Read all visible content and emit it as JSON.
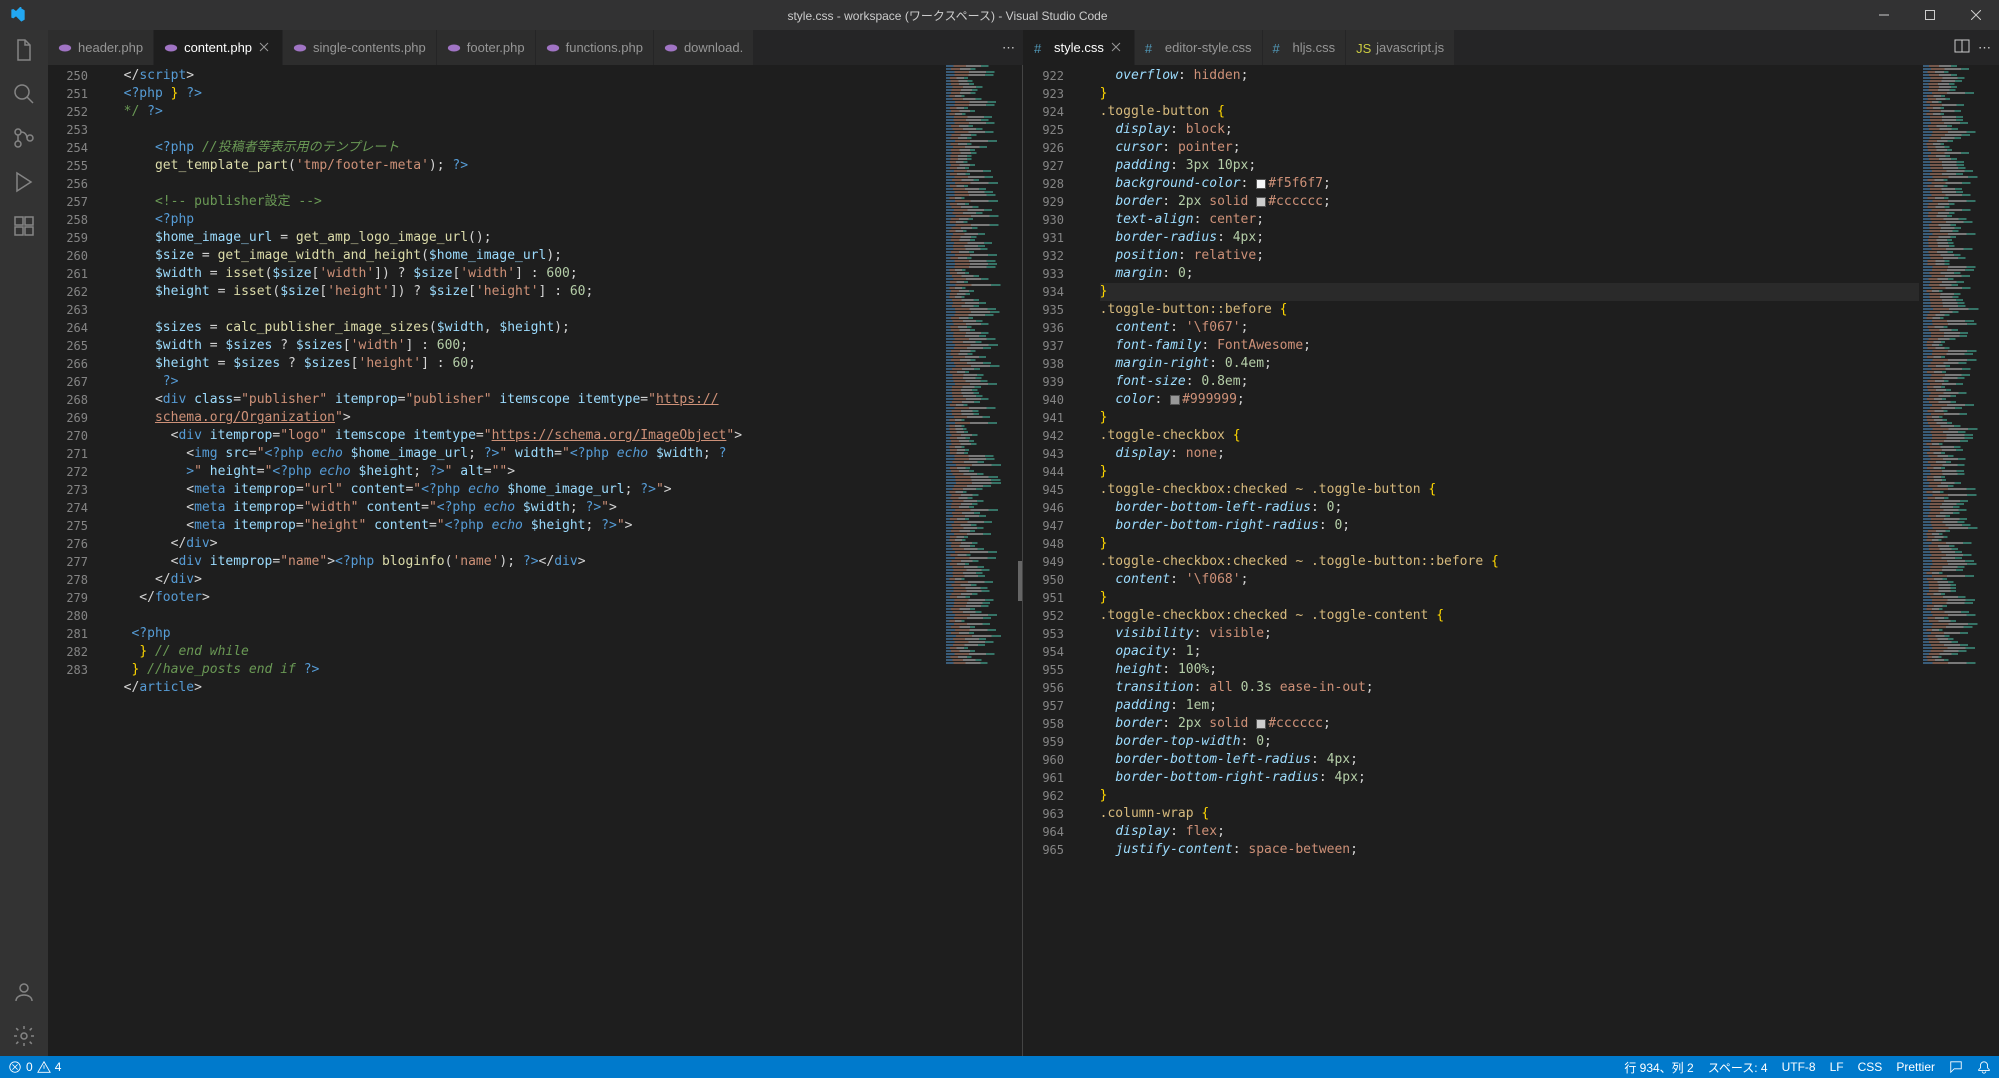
{
  "title": "style.css - workspace (ワークスペース) - Visual Studio Code",
  "activity": [
    "files",
    "search",
    "source-control",
    "run",
    "extensions"
  ],
  "activity_bottom": [
    "account",
    "gear"
  ],
  "left_tabs": [
    {
      "icon": "php",
      "label": "header.php",
      "close": false
    },
    {
      "icon": "php",
      "label": "content.php",
      "close": true,
      "active": true
    },
    {
      "icon": "php",
      "label": "single-contents.php",
      "close": false
    },
    {
      "icon": "php",
      "label": "footer.php",
      "close": false
    },
    {
      "icon": "php",
      "label": "functions.php",
      "close": false
    },
    {
      "icon": "php",
      "label": "download.",
      "close": false
    }
  ],
  "right_tabs": [
    {
      "icon": "css",
      "label": "style.css",
      "close": true,
      "active": true
    },
    {
      "icon": "css",
      "label": "editor-style.css",
      "close": false
    },
    {
      "icon": "css",
      "label": "hljs.css",
      "close": false
    },
    {
      "icon": "js",
      "label": "javascript.js",
      "close": false
    }
  ],
  "left_start_line": 250,
  "left_lines": [
    {
      "n": 250,
      "html": "  &lt;/<span class='tag'>script</span>&gt;"
    },
    {
      "n": 251,
      "html": "  <span class='phpdelim'>&lt;?php</span> <span class='brace'>}</span> <span class='phpdelim'>?&gt;</span>"
    },
    {
      "n": 252,
      "html": "  <span class='comment'>*/</span> <span class='phpdelim'>?&gt;</span>"
    },
    {
      "n": 253,
      "html": ""
    },
    {
      "n": 254,
      "html": "      <span class='phpdelim'>&lt;?php </span><span class='comment-i'>//投稿者等表示用のテンプレート</span>"
    },
    {
      "n": 255,
      "html": "      <span class='func'>get_template_part</span>(<span class='string'>'tmp/footer-meta'</span>); <span class='phpdelim'>?&gt;</span>"
    },
    {
      "n": 256,
      "html": ""
    },
    {
      "n": 257,
      "html": "      <span class='comment'>&lt;!-- publisher設定 --&gt;</span>"
    },
    {
      "n": 258,
      "html": "      <span class='phpdelim'>&lt;?php</span>"
    },
    {
      "n": 259,
      "html": "      <span class='var'>$home_image_url</span> = <span class='func'>get_amp_logo_image_url</span>();"
    },
    {
      "n": 260,
      "html": "      <span class='var'>$size</span> = <span class='func'>get_image_width_and_height</span>(<span class='var'>$home_image_url</span>);"
    },
    {
      "n": 261,
      "html": "      <span class='var'>$width</span> = <span class='func'>isset</span>(<span class='var'>$size</span>[<span class='string'>'width'</span>]) ? <span class='var'>$size</span>[<span class='string'>'width'</span>] : <span class='number'>600</span>;"
    },
    {
      "n": 262,
      "html": "      <span class='var'>$height</span> = <span class='func'>isset</span>(<span class='var'>$size</span>[<span class='string'>'height'</span>]) ? <span class='var'>$size</span>[<span class='string'>'height'</span>] : <span class='number'>60</span>;"
    },
    {
      "n": 263,
      "html": ""
    },
    {
      "n": 264,
      "html": "      <span class='var'>$sizes</span> = <span class='func'>calc_publisher_image_sizes</span>(<span class='var'>$width</span>, <span class='var'>$height</span>);"
    },
    {
      "n": 265,
      "html": "      <span class='var'>$width</span> = <span class='var'>$sizes</span> ? <span class='var'>$sizes</span>[<span class='string'>'width'</span>] : <span class='number'>600</span>;"
    },
    {
      "n": 266,
      "html": "      <span class='var'>$height</span> = <span class='var'>$sizes</span> ? <span class='var'>$sizes</span>[<span class='string'>'height'</span>] : <span class='number'>60</span>;"
    },
    {
      "n": 267,
      "html": "       <span class='phpdelim'>?&gt;</span>"
    },
    {
      "n": 268,
      "html": "      &lt;<span class='tag'>div</span> <span class='attr'>class</span>=<span class='string'>\"publisher\"</span> <span class='attr'>itemprop</span>=<span class='string'>\"publisher\"</span> <span class='attr'>itemscope</span> <span class='attr'>itemtype</span>=<span class='string'>\"<span class='url'>https://</span></span><br>      <span class='url'>schema.org/Organization</span><span class='string'>\"</span>&gt;"
    },
    {
      "n": 269,
      "html": "        &lt;<span class='tag'>div</span> <span class='attr'>itemprop</span>=<span class='string'>\"logo\"</span> <span class='attr'>itemscope</span> <span class='attr'>itemtype</span>=<span class='string'>\"<span class='url'>https://schema.org/ImageObject</span>\"</span>&gt;"
    },
    {
      "n": 270,
      "html": "          &lt;<span class='tag'>img</span> <span class='attr'>src</span>=<span class='string'>\"</span><span class='phpdelim'>&lt;?php</span> <span class='keyword'>echo</span> <span class='var'>$home_image_url</span>; <span class='phpdelim'>?&gt;</span><span class='string'>\"</span> <span class='attr'>width</span>=<span class='string'>\"</span><span class='phpdelim'>&lt;?php</span> <span class='keyword'>echo</span> <span class='var'>$width</span>; <span class='phpdelim'>?</span><br>          <span class='phpdelim'>&gt;</span><span class='string'>\"</span> <span class='attr'>height</span>=<span class='string'>\"</span><span class='phpdelim'>&lt;?php</span> <span class='keyword'>echo</span> <span class='var'>$height</span>; <span class='phpdelim'>?&gt;</span><span class='string'>\"</span> <span class='attr'>alt</span>=<span class='string'>\"\"</span>&gt;"
    },
    {
      "n": 271,
      "html": "          &lt;<span class='tag'>meta</span> <span class='attr'>itemprop</span>=<span class='string'>\"url\"</span> <span class='attr'>content</span>=<span class='string'>\"</span><span class='phpdelim'>&lt;?php</span> <span class='keyword'>echo</span> <span class='var'>$home_image_url</span>; <span class='phpdelim'>?&gt;</span><span class='string'>\"</span>&gt;"
    },
    {
      "n": 272,
      "html": "          &lt;<span class='tag'>meta</span> <span class='attr'>itemprop</span>=<span class='string'>\"width\"</span> <span class='attr'>content</span>=<span class='string'>\"</span><span class='phpdelim'>&lt;?php</span> <span class='keyword'>echo</span> <span class='var'>$width</span>; <span class='phpdelim'>?&gt;</span><span class='string'>\"</span>&gt;"
    },
    {
      "n": 273,
      "html": "          &lt;<span class='tag'>meta</span> <span class='attr'>itemprop</span>=<span class='string'>\"height\"</span> <span class='attr'>content</span>=<span class='string'>\"</span><span class='phpdelim'>&lt;?php</span> <span class='keyword'>echo</span> <span class='var'>$height</span>; <span class='phpdelim'>?&gt;</span><span class='string'>\"</span>&gt;"
    },
    {
      "n": 274,
      "html": "        &lt;/<span class='tag'>div</span>&gt;"
    },
    {
      "n": 275,
      "html": "        &lt;<span class='tag'>div</span> <span class='attr'>itemprop</span>=<span class='string'>\"name\"</span>&gt;<span class='phpdelim'>&lt;?php</span> <span class='func'>bloginfo</span>(<span class='string'>'name'</span>); <span class='phpdelim'>?&gt;</span>&lt;/<span class='tag'>div</span>&gt;"
    },
    {
      "n": 276,
      "html": "      &lt;/<span class='tag'>div</span>&gt;"
    },
    {
      "n": 277,
      "html": "    &lt;/<span class='tag'>footer</span>&gt;"
    },
    {
      "n": 278,
      "html": ""
    },
    {
      "n": 279,
      "html": "   <span class='phpdelim'>&lt;?php</span>"
    },
    {
      "n": 280,
      "html": "    <span class='brace'>}</span> <span class='comment-i'>// end while</span>"
    },
    {
      "n": 281,
      "html": "   <span class='brace'>}</span> <span class='comment-i'>//have_posts end if</span> <span class='phpdelim'>?&gt;</span>"
    },
    {
      "n": 282,
      "html": "  &lt;/<span class='tag'>article</span>&gt;"
    },
    {
      "n": 283,
      "html": ""
    }
  ],
  "right_start_line": 922,
  "right_lines": [
    {
      "n": 922,
      "html": "    <span class='prop'>overflow</span>: <span class='value'>hidden</span>;"
    },
    {
      "n": 923,
      "html": "  <span class='brace'>}</span>"
    },
    {
      "n": 924,
      "html": "  <span class='selector'>.toggle-button</span> <span class='brace'>{</span>"
    },
    {
      "n": 925,
      "html": "    <span class='prop'>display</span>: <span class='value'>block</span>;"
    },
    {
      "n": 926,
      "html": "    <span class='prop'>cursor</span>: <span class='value'>pointer</span>;"
    },
    {
      "n": 927,
      "html": "    <span class='prop'>padding</span>: <span class='num'>3</span><span class='unit'>px</span> <span class='num'>10</span><span class='unit'>px</span>;"
    },
    {
      "n": 928,
      "html": "    <span class='prop'>background-color</span>: <span class='color-swatch' style='background:#f5f6f7'></span><span class='value'>#f5f6f7</span>;"
    },
    {
      "n": 929,
      "html": "    <span class='prop'>border</span>: <span class='num'>2</span><span class='unit'>px</span> <span class='value'>solid</span> <span class='color-swatch' style='background:#cccccc'></span><span class='value'>#cccccc</span>;"
    },
    {
      "n": 930,
      "html": "    <span class='prop'>text-align</span>: <span class='value'>center</span>;"
    },
    {
      "n": 931,
      "html": "    <span class='prop'>border-radius</span>: <span class='num'>4</span><span class='unit'>px</span>;"
    },
    {
      "n": 932,
      "html": "    <span class='prop'>position</span>: <span class='value'>relative</span>;"
    },
    {
      "n": 933,
      "html": "    <span class='prop'>margin</span>: <span class='num'>0</span>;"
    },
    {
      "n": 934,
      "html": "  <span class='line-highlight'><span class='brace'>}</span></span>",
      "hl": true
    },
    {
      "n": 935,
      "html": "  <span class='selector'>.toggle-button::before</span> <span class='brace'>{</span>"
    },
    {
      "n": 936,
      "html": "    <span class='prop'>content</span>: <span class='string'>'\\f067'</span>;"
    },
    {
      "n": 937,
      "html": "    <span class='prop'>font-family</span>: <span class='value'>FontAwesome</span>;"
    },
    {
      "n": 938,
      "html": "    <span class='prop'>margin-right</span>: <span class='num'>0.4</span><span class='unit'>em</span>;"
    },
    {
      "n": 939,
      "html": "    <span class='prop'>font-size</span>: <span class='num'>0.8</span><span class='unit'>em</span>;"
    },
    {
      "n": 940,
      "html": "    <span class='prop'>color</span>: <span class='color-swatch' style='background:#999999'></span><span class='value'>#999999</span>;"
    },
    {
      "n": 941,
      "html": "  <span class='brace'>}</span>"
    },
    {
      "n": 942,
      "html": "  <span class='selector'>.toggle-checkbox</span> <span class='brace'>{</span>"
    },
    {
      "n": 943,
      "html": "    <span class='prop'>display</span>: <span class='value'>none</span>;"
    },
    {
      "n": 944,
      "html": "  <span class='brace'>}</span>"
    },
    {
      "n": 945,
      "html": "  <span class='selector'>.toggle-checkbox:checked ~ .toggle-button</span> <span class='brace'>{</span>"
    },
    {
      "n": 946,
      "html": "    <span class='prop'>border-bottom-left-radius</span>: <span class='num'>0</span>;"
    },
    {
      "n": 947,
      "html": "    <span class='prop'>border-bottom-right-radius</span>: <span class='num'>0</span>;"
    },
    {
      "n": 948,
      "html": "  <span class='brace'>}</span>"
    },
    {
      "n": 949,
      "html": "  <span class='selector'>.toggle-checkbox:checked ~ .toggle-button::before</span> <span class='brace'>{</span>"
    },
    {
      "n": 950,
      "html": "    <span class='prop'>content</span>: <span class='string'>'\\f068'</span>;"
    },
    {
      "n": 951,
      "html": "  <span class='brace'>}</span>"
    },
    {
      "n": 952,
      "html": "  <span class='selector'>.toggle-checkbox:checked ~ .toggle-content</span> <span class='brace'>{</span>"
    },
    {
      "n": 953,
      "html": "    <span class='prop'>visibility</span>: <span class='value'>visible</span>;"
    },
    {
      "n": 954,
      "html": "    <span class='prop'>opacity</span>: <span class='num'>1</span>;"
    },
    {
      "n": 955,
      "html": "    <span class='prop'>height</span>: <span class='num'>100</span><span class='unit'>%</span>;"
    },
    {
      "n": 956,
      "html": "    <span class='prop'>transition</span>: <span class='value'>all</span> <span class='num'>0.3</span><span class='unit'>s</span> <span class='value'>ease-in-out</span>;"
    },
    {
      "n": 957,
      "html": "    <span class='prop'>padding</span>: <span class='num'>1</span><span class='unit'>em</span>;"
    },
    {
      "n": 958,
      "html": "    <span class='prop'>border</span>: <span class='num'>2</span><span class='unit'>px</span> <span class='value'>solid</span> <span class='color-swatch' style='background:#cccccc'></span><span class='value'>#cccccc</span>;"
    },
    {
      "n": 959,
      "html": "    <span class='prop'>border-top-width</span>: <span class='num'>0</span>;"
    },
    {
      "n": 960,
      "html": "    <span class='prop'>border-bottom-left-radius</span>: <span class='num'>4</span><span class='unit'>px</span>;"
    },
    {
      "n": 961,
      "html": "    <span class='prop'>border-bottom-right-radius</span>: <span class='num'>4</span><span class='unit'>px</span>;"
    },
    {
      "n": 962,
      "html": "  <span class='brace'>}</span>"
    },
    {
      "n": 963,
      "html": "  <span class='selector'>.column-wrap</span> <span class='brace'>{</span>"
    },
    {
      "n": 964,
      "html": "    <span class='prop'>display</span>: <span class='value'>flex</span>;"
    },
    {
      "n": 965,
      "html": "    <span class='prop'>justify-content</span>: <span class='value'>space-between</span>;"
    }
  ],
  "status": {
    "errors": "0",
    "warnings": "4",
    "ln_col": "行 934、列 2",
    "spaces": "スペース: 4",
    "encoding": "UTF-8",
    "eol": "LF",
    "lang": "CSS",
    "prettier": "Prettier"
  }
}
